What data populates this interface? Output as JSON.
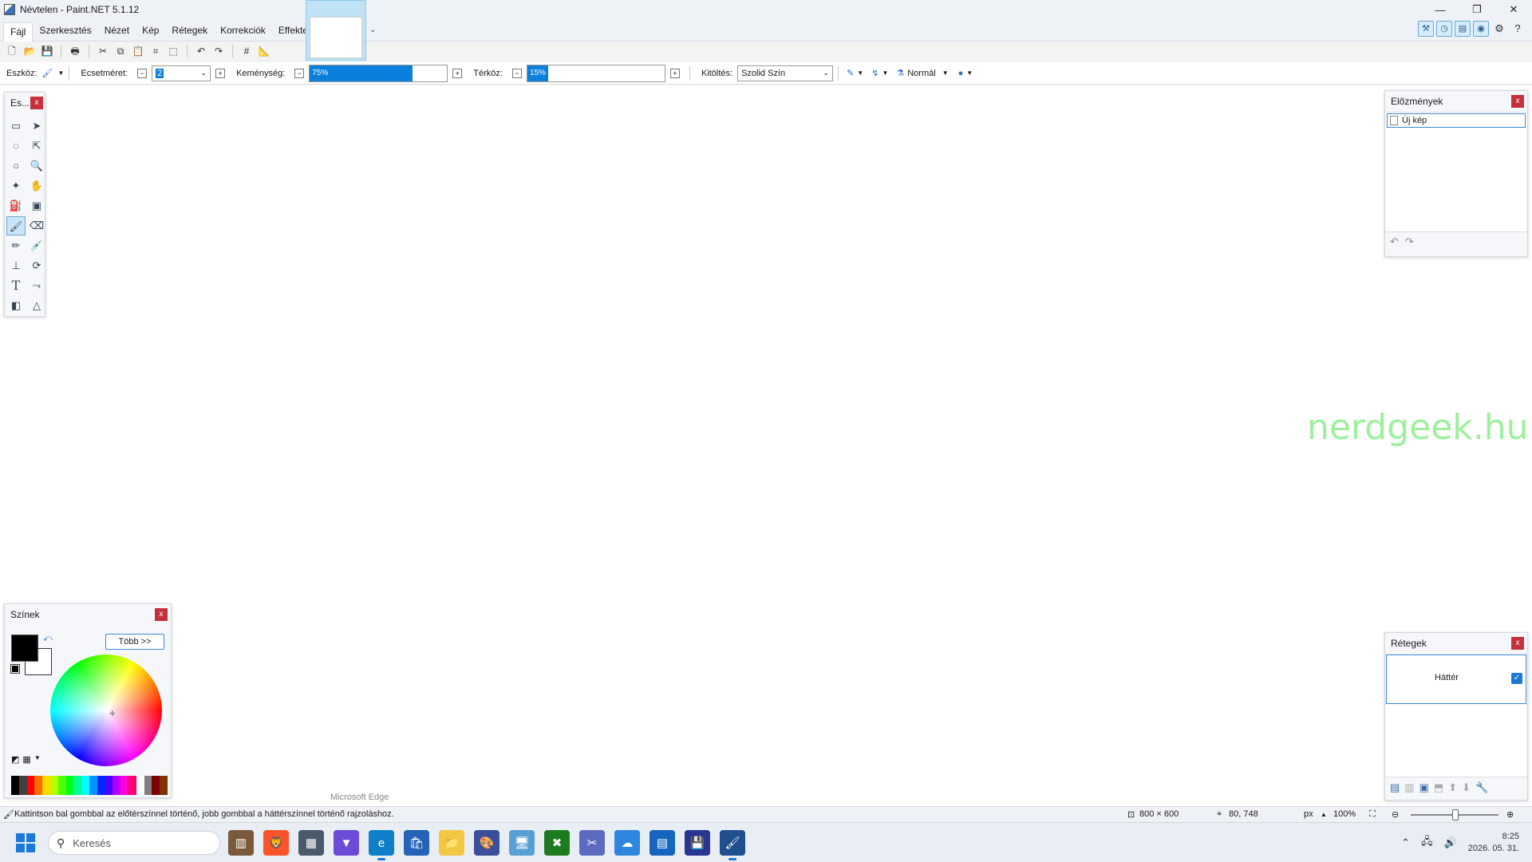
{
  "window": {
    "title": "Névtelen - Paint.NET 5.1.12"
  },
  "menu": [
    "Fájl",
    "Szerkesztés",
    "Nézet",
    "Kép",
    "Rétegek",
    "Korrekciók",
    "Effektek"
  ],
  "toolbar_options": {
    "tool_label": "Eszköz:",
    "brush_size_label": "Ecsetméret:",
    "brush_size_value": "2",
    "hardness_label": "Keménység:",
    "hardness_value": "75%",
    "hardness_fraction": 0.75,
    "spacing_label": "Térköz:",
    "spacing_value": "15%",
    "spacing_fraction": 0.15,
    "fill_label": "Kitöltés:",
    "fill_value": "Szolid Szín",
    "blend_mode": "Normál"
  },
  "tools_panel": {
    "title": "Es...",
    "close": "x"
  },
  "history_panel": {
    "title": "Előzmények",
    "close": "x",
    "items": [
      "Új kép"
    ]
  },
  "layers_panel": {
    "title": "Rétegek",
    "close": "x",
    "layers": [
      {
        "name": "Háttér",
        "visible": true
      }
    ]
  },
  "colors_panel": {
    "title": "Színek",
    "close": "x",
    "more_button": "Több >>",
    "primary_color": "#000000",
    "secondary_color": "#ffffff",
    "palette": [
      "#000000",
      "#404040",
      "#ff0000",
      "#ff6a00",
      "#ffd800",
      "#b6ff00",
      "#4cff00",
      "#00ff21",
      "#00ff90",
      "#00ffff",
      "#0094ff",
      "#0026ff",
      "#4800ff",
      "#b200ff",
      "#ff00dc",
      "#ff006e",
      "#ffffff",
      "#808080",
      "#7f0000",
      "#7f3300"
    ]
  },
  "status": {
    "hint": "Kattintson bal gombbal az előtérszínnel történő, jobb gombbal a háttérszínnel történő rajzoláshoz.",
    "image_size": "800 × 600",
    "cursor_pos": "80, 748",
    "units": "px",
    "zoom": "100%"
  },
  "taskbar": {
    "search_placeholder": "Keresés",
    "tooltip": "Microsoft Edge",
    "time": "8:25",
    "date": "2026. 05. 31."
  },
  "watermark": "nerdgeek.hu",
  "accent_color": "#0a7fdb"
}
